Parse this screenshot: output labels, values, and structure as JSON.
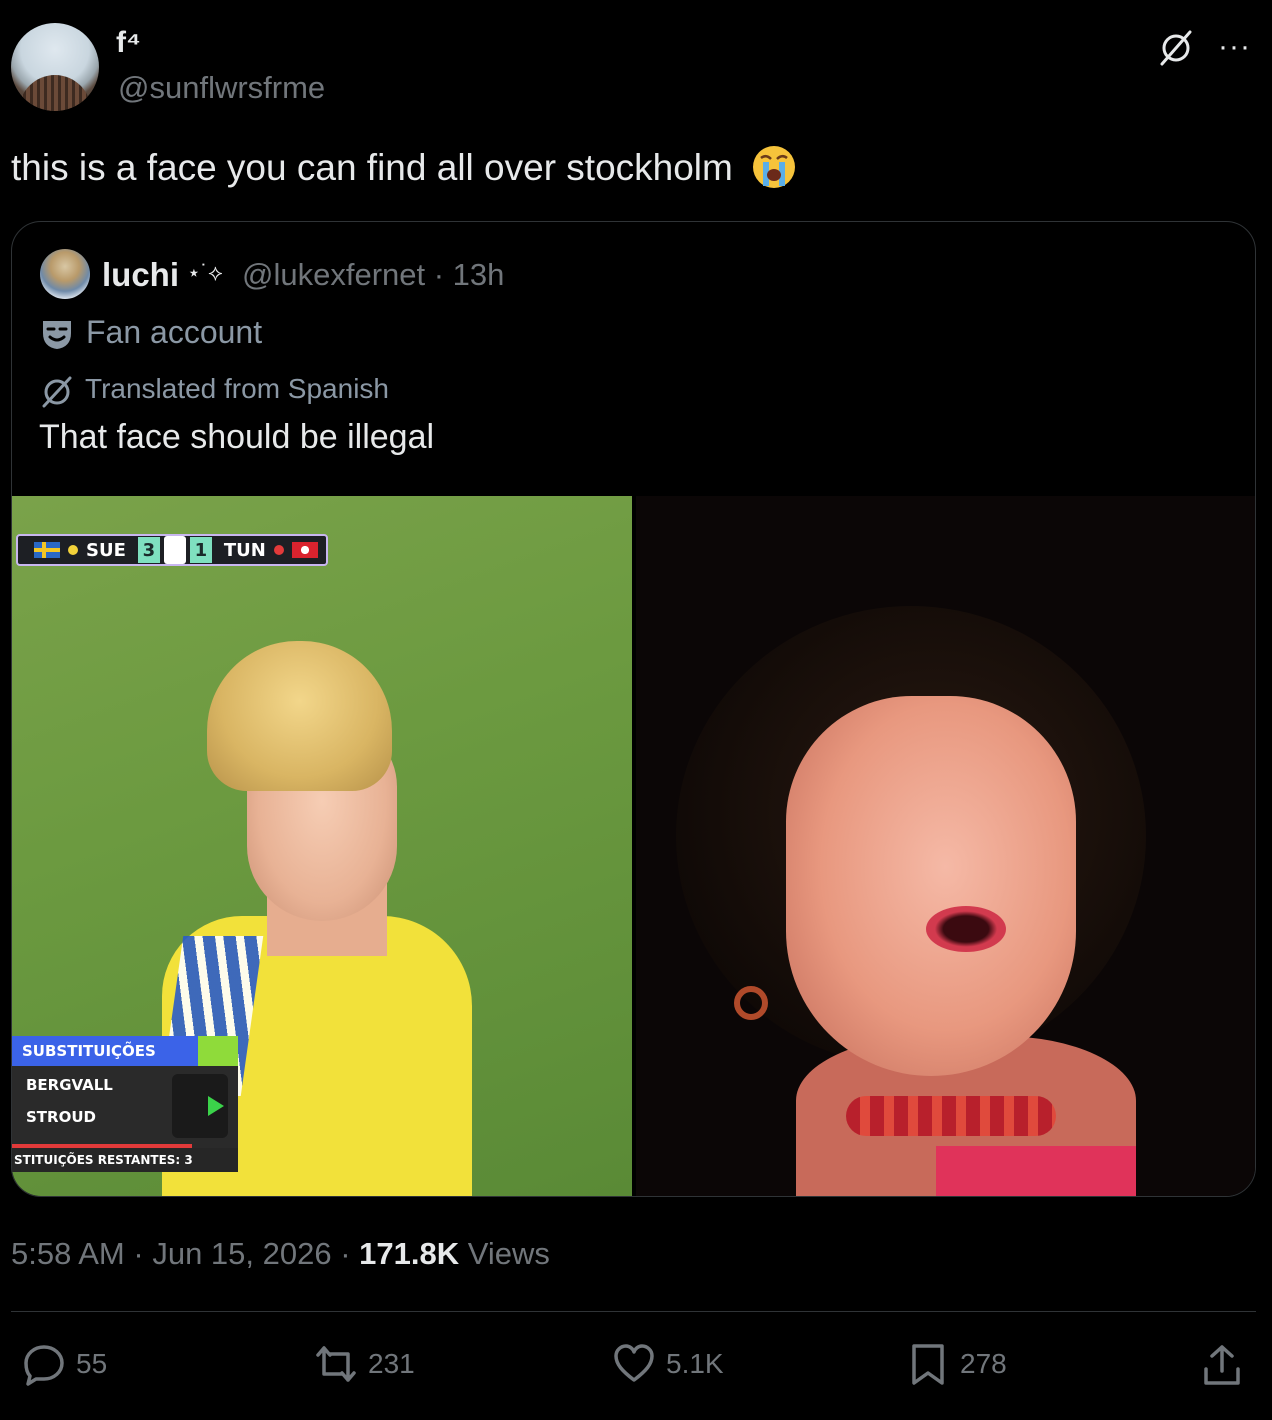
{
  "post": {
    "display_name": "f⁴",
    "handle": "@sunflwrsfrme",
    "text": "this is a face you can find all over stockholm",
    "emoji_name": "loudly-crying-face",
    "timestamp_time": "5:58 AM",
    "timestamp_sep": "·",
    "timestamp_date": "Jun 15, 2026",
    "views_count": "171.8K",
    "views_label": "Views"
  },
  "quote": {
    "display_name": "luchi",
    "sparkle": "⋆˙⟡",
    "handle_time": "@lukexfernet · 13h",
    "label": "Fan account",
    "translated": "Translated from Spanish",
    "text": "That face should be illegal",
    "scoreboard": {
      "home": "SUE",
      "home_score": "3",
      "away_score": "1",
      "away": "TUN"
    },
    "subs_panel": {
      "title": "SUBSTITUIÇÕES",
      "row1": "BERGVALL",
      "row2": "STROUD",
      "footer": "STITUIÇÕES RESTANTES: 3"
    }
  },
  "actions": {
    "replies": "55",
    "reposts": "231",
    "likes": "5.1K",
    "bookmarks": "278"
  },
  "colors": {
    "background": "#000000",
    "text_primary": "#e7e9ea",
    "text_secondary": "#71767b",
    "border": "#2f3336"
  }
}
